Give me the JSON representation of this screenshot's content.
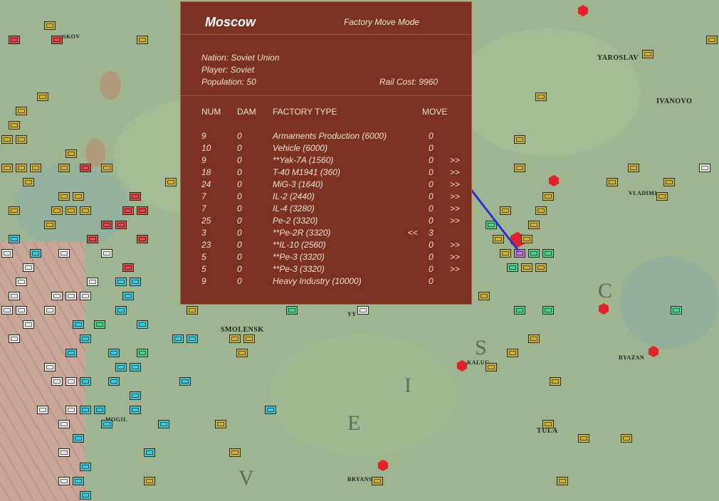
{
  "panel": {
    "city": "Moscow",
    "mode": "Factory Move Mode",
    "nation": "Nation: Soviet Union",
    "player": "Player: Soviet",
    "population": "Population: 50",
    "rail_cost": "Rail Cost: 9960",
    "headers": {
      "num": "NUM",
      "dam": "DAM",
      "type": "FACTORY TYPE",
      "move": "MOVE"
    },
    "factories": [
      {
        "num": "9",
        "dam": "0",
        "type": "Armaments Production (6000)",
        "left": "",
        "move": "0",
        "right": ""
      },
      {
        "num": "10",
        "dam": "0",
        "type": "Vehicle (6000)",
        "left": "",
        "move": "0",
        "right": ""
      },
      {
        "num": "9",
        "dam": "0",
        "type": "**Yak-7A (1560)",
        "left": "",
        "move": "0",
        "right": ">>"
      },
      {
        "num": "18",
        "dam": "0",
        "type": "T-40 M1941 (360)",
        "left": "",
        "move": "0",
        "right": ">>"
      },
      {
        "num": "24",
        "dam": "0",
        "type": "MiG-3 (1640)",
        "left": "",
        "move": "0",
        "right": ">>"
      },
      {
        "num": "7",
        "dam": "0",
        "type": "IL-2 (2440)",
        "left": "",
        "move": "0",
        "right": ">>"
      },
      {
        "num": "7",
        "dam": "0",
        "type": "IL-4 (3280)",
        "left": "",
        "move": "0",
        "right": ">>"
      },
      {
        "num": "25",
        "dam": "0",
        "type": "Pe-2 (3320)",
        "left": "",
        "move": "0",
        "right": ">>"
      },
      {
        "num": "3",
        "dam": "0",
        "type": "**Pe-2R (3320)",
        "left": "<<",
        "move": "3",
        "right": ""
      },
      {
        "num": "23",
        "dam": "0",
        "type": "**IL-10 (2560)",
        "left": "",
        "move": "0",
        "right": ">>"
      },
      {
        "num": "5",
        "dam": "0",
        "type": "**Pe-3 (3320)",
        "left": "",
        "move": "0",
        "right": ">>"
      },
      {
        "num": "5",
        "dam": "0",
        "type": "**Pe-3 (3320)",
        "left": "",
        "move": "0",
        "right": ">>"
      },
      {
        "num": "9",
        "dam": "0",
        "type": "Heavy Industry (10000)",
        "left": "",
        "move": "0",
        "right": ""
      }
    ]
  },
  "map": {
    "cities": [
      "YAROSLAV",
      "IVANOVO",
      "VLADIMI",
      "SMOLENSK",
      "RYAZAN",
      "TULA",
      "BRYANSK",
      "KALUG",
      "MOGIL",
      "SKOV",
      "YY"
    ],
    "region_letters": [
      "S",
      "I",
      "E",
      "V",
      "C"
    ]
  },
  "colors": {
    "panel_bg": "#7d3120",
    "soviet_unit": "#c9b13a",
    "german_unit": "#45c6d6",
    "axis_allied_unit": "#d94d4d",
    "route_line": "#2b2fd0"
  }
}
